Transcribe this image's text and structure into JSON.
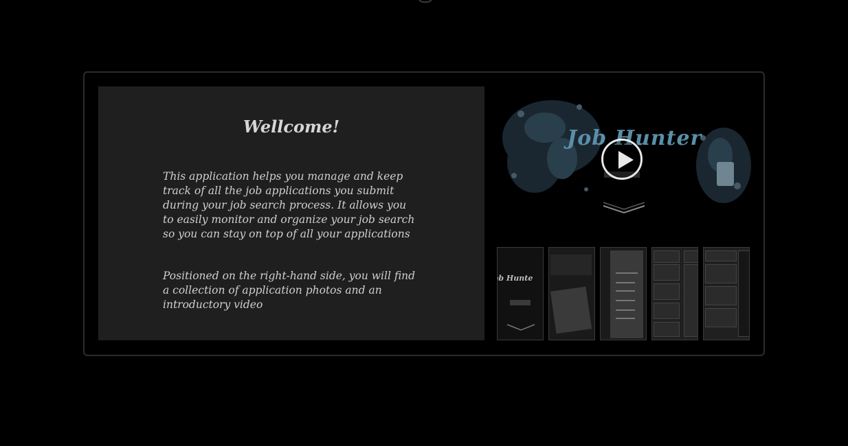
{
  "intro": {
    "title": "Wellcome!",
    "paragraph_1": "This application helps you manage and keep track of all the job applications you submit during your job search process. It allows you to easily monitor and organize your job search so you can stay on top of all your applications",
    "paragraph_2": "Positioned on the right-hand side, you will find a collection of application photos and an introductory video"
  },
  "video": {
    "brand_text": "Job Hunter",
    "icons": [
      "play-icon",
      "chevron-down-icon"
    ]
  },
  "thumbnails": {
    "count": 5,
    "thumb_1_text": "ob Hunte"
  },
  "colors": {
    "background": "#000000",
    "panel": "#1f1f1f",
    "text": "#d0d0d0",
    "brand": "#5a8fa8"
  }
}
